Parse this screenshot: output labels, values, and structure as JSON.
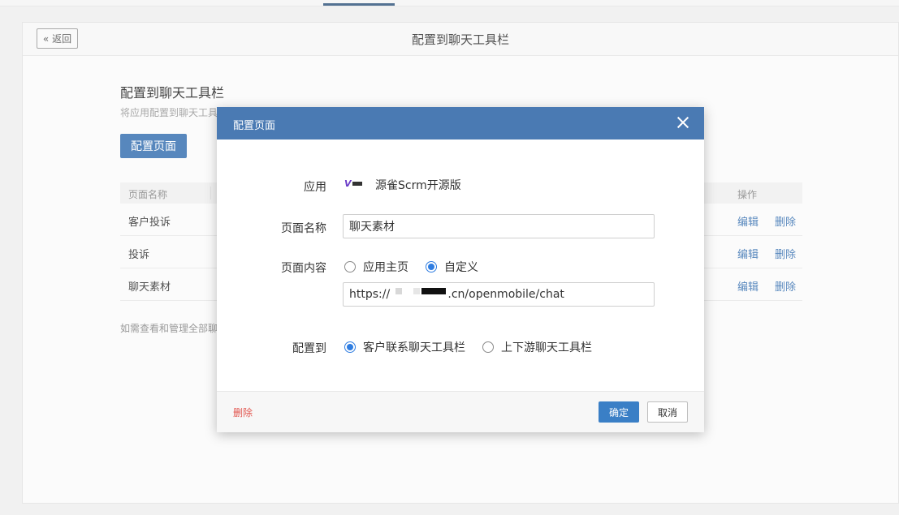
{
  "page": {
    "back_label": "« 返回",
    "title": "配置到聊天工具栏",
    "section_title": "配置到聊天工具栏",
    "section_desc": "将应用配置到聊天工具栏",
    "config_button": "配置页面",
    "table": {
      "headers": [
        "页面名称",
        "操作"
      ],
      "rows": [
        {
          "name": "客户投诉",
          "edit": "编辑",
          "delete": "删除"
        },
        {
          "name": "投诉",
          "edit": "编辑",
          "delete": "删除"
        },
        {
          "name": "聊天素材",
          "edit": "编辑",
          "delete": "删除"
        }
      ]
    },
    "footnote": "如需查看和管理全部聊天工具栏"
  },
  "modal": {
    "title": "配置页面",
    "app_label": "应用",
    "app_name": "源雀Scrm开源版",
    "page_name_label": "页面名称",
    "page_name_value": "聊天素材",
    "page_content_label": "页面内容",
    "content_options": [
      {
        "label": "应用主页",
        "checked": false
      },
      {
        "label": "自定义",
        "checked": true
      }
    ],
    "url_value": "https://                .cn/openmobile/chat",
    "config_to_label": "配置到",
    "config_to_options": [
      {
        "label": "客户联系聊天工具栏",
        "checked": true
      },
      {
        "label": "上下游聊天工具栏",
        "checked": false
      }
    ],
    "delete_label": "删除",
    "ok_label": "确定",
    "cancel_label": "取消"
  },
  "colors": {
    "modal_header": "#4a7ab3",
    "primary": "#3a73b2",
    "radio_checked": "#2f7de1",
    "danger": "#e2564f"
  }
}
